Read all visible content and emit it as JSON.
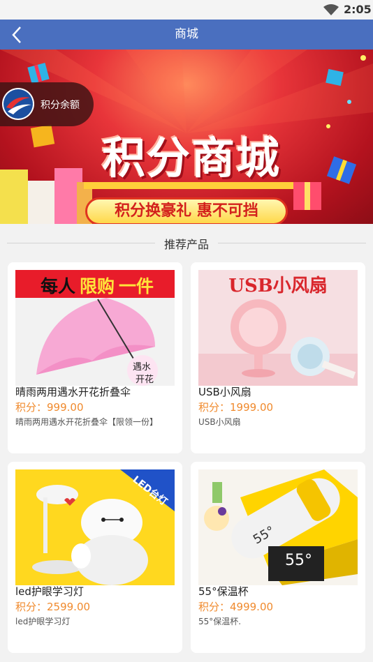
{
  "status_bar": {
    "time": "2:05"
  },
  "app_bar": {
    "title": "商城"
  },
  "banner": {
    "title": "积分商城",
    "subtitle": "积分换豪礼 惠不可挡"
  },
  "points": {
    "label": "积分余额"
  },
  "section": {
    "title": "推荐产品"
  },
  "products": [
    {
      "name": "晴雨两用遇水开花折叠伞",
      "price": "积分：999.00",
      "desc": "晴雨两用遇水开花折叠伞【限领一份】",
      "image_text": {
        "banner_a": "每人",
        "banner_b": "限购",
        "banner_c": "一件",
        "tag_a": "遇水",
        "tag_b": "开花"
      }
    },
    {
      "name": "USB小风扇",
      "price": "积分：1999.00",
      "desc": "USB小风扇",
      "image_text": {
        "title": "USB小风扇"
      }
    },
    {
      "name": "led护眼学习灯",
      "price": "积分：2599.00",
      "desc": "led护眼学习灯",
      "image_text": {
        "corner": "LED台灯"
      }
    },
    {
      "name": "55°保温杯",
      "price": "积分：4999.00",
      "desc": "55°保温杯.",
      "image_text": {
        "cup": "55°",
        "box": "55°"
      }
    }
  ]
}
